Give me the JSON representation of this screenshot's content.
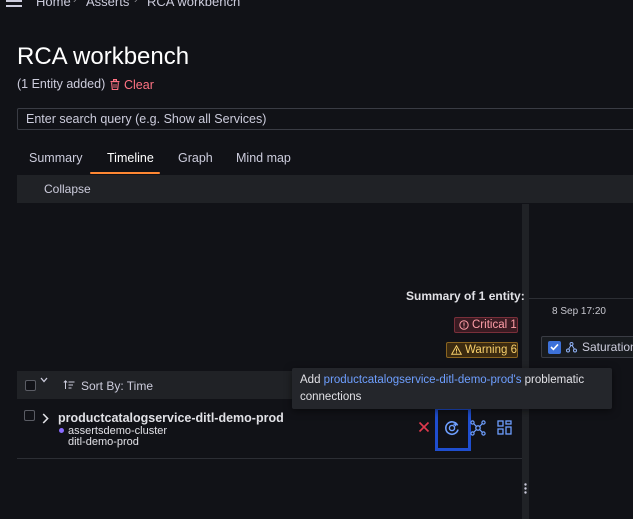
{
  "breadcrumb": {
    "items": [
      "Home",
      "Asserts",
      "RCA workbench"
    ]
  },
  "page": {
    "title": "RCA workbench",
    "entity_count_label": "(1 Entity added)",
    "clear_label": "Clear"
  },
  "search": {
    "placeholder": "Enter search query (e.g. Show all Services)"
  },
  "tabs": [
    {
      "label": "Summary",
      "active": false
    },
    {
      "label": "Timeline",
      "active": true
    },
    {
      "label": "Graph",
      "active": false
    },
    {
      "label": "Mind map",
      "active": false
    }
  ],
  "toolbar": {
    "collapse_label": "Collapse"
  },
  "summary": {
    "title": "Summary of 1 entity:",
    "critical_label": "Critical 1",
    "warning_label": "Warning 6"
  },
  "timeline": {
    "time_label": "8 Sep 17:20",
    "filter_chip_label": "Saturation",
    "filter_chip_checked": true
  },
  "list": {
    "sort_label": "Sort By: Time",
    "rows": [
      {
        "name": "productcatalogservice-ditl-demo-prod",
        "env": "assertsdemo-cluster",
        "site": "ditl-demo-prod"
      }
    ]
  },
  "tooltip": {
    "prefix": "Add ",
    "entity": "productcatalogservice-ditl-demo-prod's",
    "suffix": " problematic connections"
  },
  "icons": {
    "menu": "hamburger-icon",
    "clear": "trash-icon",
    "sort": "sort-icon",
    "remove": "close-icon",
    "add_connections": "add-connections-icon",
    "graph": "graph-icon",
    "grid": "grid-icon"
  },
  "colors": {
    "background": "#111217",
    "accent_tab": "#ff8833",
    "clear": "#ff7383",
    "critical": "#ff9ea8",
    "warning": "#f8d06b",
    "link": "#6e9fff",
    "focus_box": "#1f4ecf"
  }
}
